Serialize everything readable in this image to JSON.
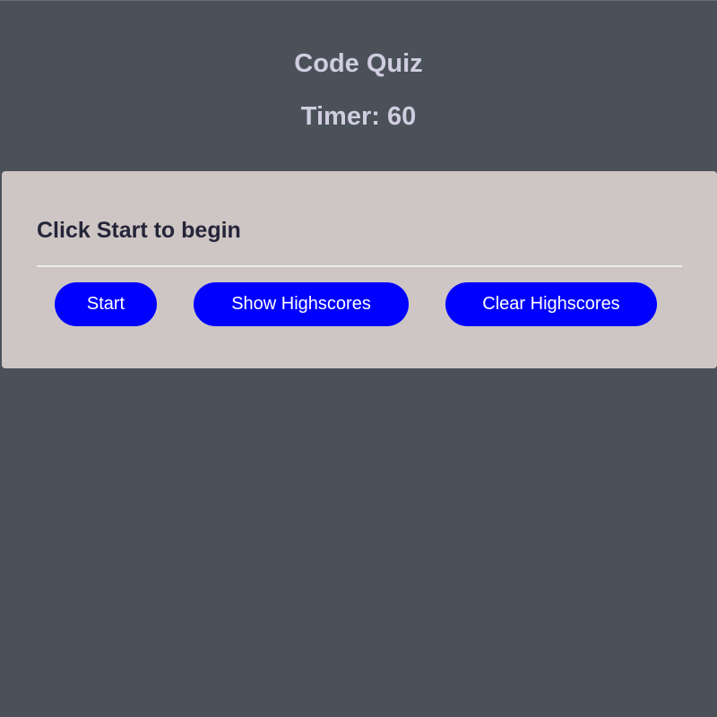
{
  "header": {
    "title": "Code Quiz",
    "timer": "Timer: 60"
  },
  "card": {
    "prompt": "Click Start to begin",
    "buttons": {
      "start": "Start",
      "show_highscores": "Show Highscores",
      "clear_highscores": "Clear Highscores"
    }
  },
  "colors": {
    "background": "#4b5159",
    "card": "#cec6c4",
    "button": "#0000ff"
  }
}
